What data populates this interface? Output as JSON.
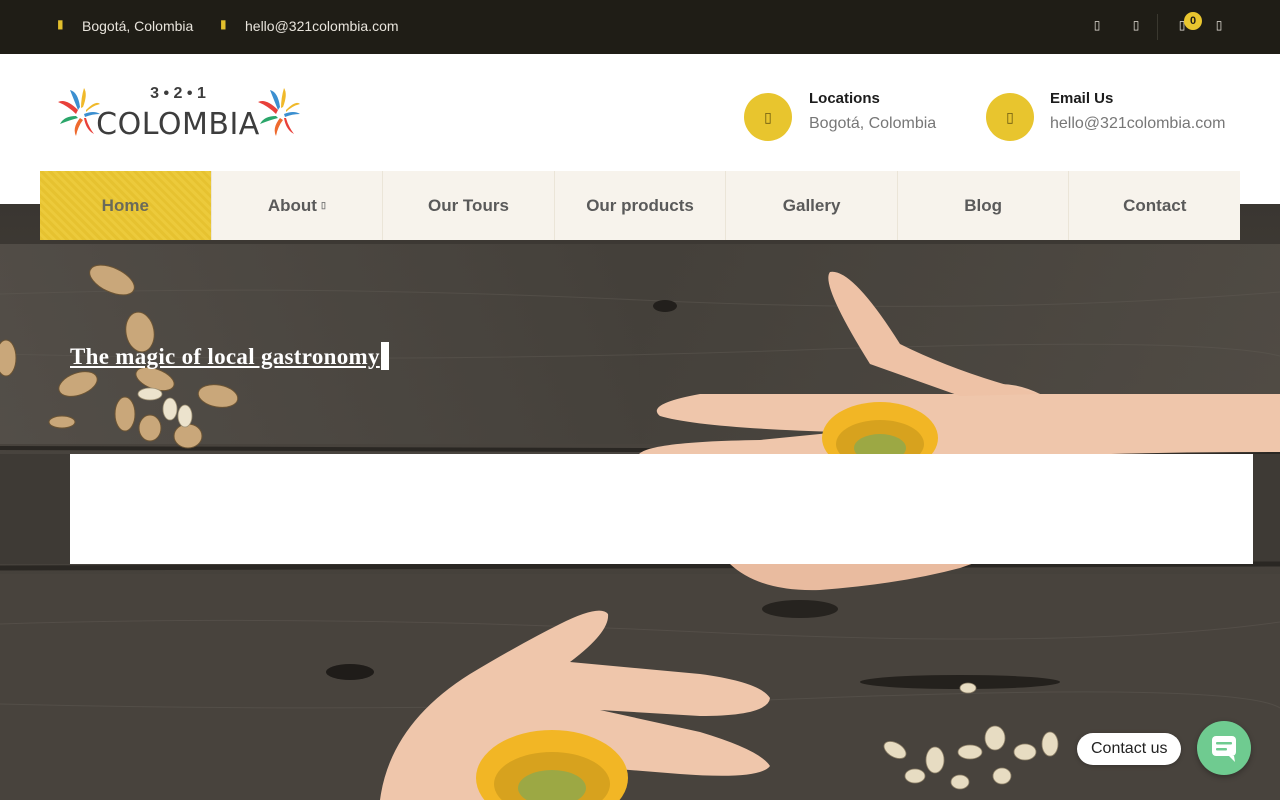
{
  "topbar": {
    "location": "Bogotá, Colombia",
    "email": "hello@321colombia.com",
    "location_icon": "map-marker-icon",
    "email_icon": "envelope-icon",
    "cart_count": "0"
  },
  "logo": {
    "numbers": "3 • 2 • 1",
    "word": "COLOMBIA"
  },
  "header": {
    "locations_title": "Locations",
    "locations_value": "Bogotá, Colombia",
    "email_title": "Email Us",
    "email_value": "hello@321colombia.com"
  },
  "nav": {
    "items": [
      {
        "label": "Home",
        "active": true
      },
      {
        "label": "About",
        "has_dropdown": true
      },
      {
        "label": "Our Tours"
      },
      {
        "label": "Our products"
      },
      {
        "label": "Gallery"
      },
      {
        "label": "Blog"
      },
      {
        "label": "Contact"
      }
    ]
  },
  "hero": {
    "headline": "The magic of local gastronomy"
  },
  "chat": {
    "label": "Contact us"
  },
  "colors": {
    "accent": "#e8c52e",
    "topbar": "#1f1d16",
    "chat": "#6fcb90"
  }
}
